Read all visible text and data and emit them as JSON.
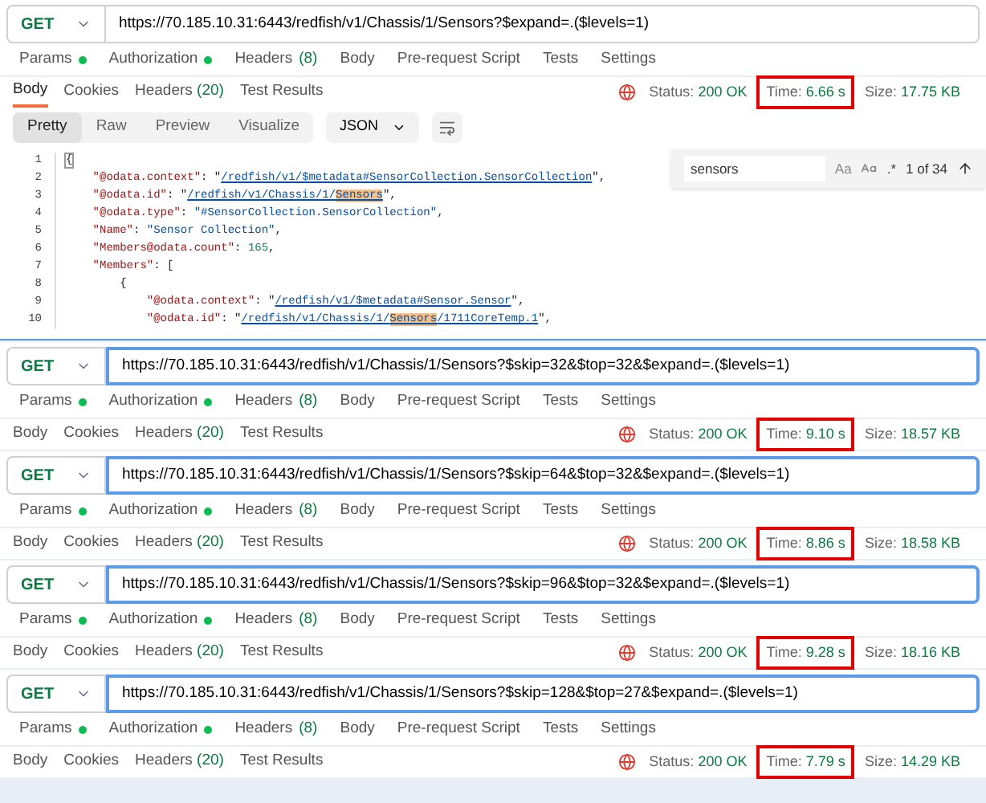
{
  "panels": [
    {
      "method": "GET",
      "url": "https://70.185.10.31:6443/redfish/v1/Chassis/1/Sensors?$expand=.($levels=1)",
      "focused": false,
      "request_tabs": [
        {
          "label": "Params",
          "dot": true
        },
        {
          "label": "Authorization",
          "dot": true
        },
        {
          "label": "Headers",
          "count": "(8)",
          "dot": false
        },
        {
          "label": "Body",
          "dot": false
        },
        {
          "label": "Pre-request Script",
          "dot": false
        },
        {
          "label": "Tests",
          "dot": false
        },
        {
          "label": "Settings",
          "dot": false
        }
      ],
      "response_tabs": [
        {
          "label": "Body",
          "selected": true
        },
        {
          "label": "Cookies",
          "selected": false
        },
        {
          "label": "Headers",
          "count": "(20)",
          "selected": false
        },
        {
          "label": "Test Results",
          "selected": false
        }
      ],
      "status_label": "Status:",
      "status": "200 OK",
      "time_label": "Time:",
      "time": "6.66 s",
      "time_highlighted": true,
      "size_label": "Size:",
      "size": "17.75 KB"
    },
    {
      "method": "GET",
      "url": "https://70.185.10.31:6443/redfish/v1/Chassis/1/Sensors?$skip=32&$top=32&$expand=.($levels=1)",
      "focused": true,
      "request_tabs": [
        {
          "label": "Params",
          "dot": true
        },
        {
          "label": "Authorization",
          "dot": true
        },
        {
          "label": "Headers",
          "count": "(8)",
          "dot": false
        },
        {
          "label": "Body",
          "dot": false
        },
        {
          "label": "Pre-request Script",
          "dot": false
        },
        {
          "label": "Tests",
          "dot": false
        },
        {
          "label": "Settings",
          "dot": false
        }
      ],
      "response_tabs": [
        {
          "label": "Body",
          "selected": false
        },
        {
          "label": "Cookies",
          "selected": false
        },
        {
          "label": "Headers",
          "count": "(20)",
          "selected": false
        },
        {
          "label": "Test Results",
          "selected": false
        }
      ],
      "status_label": "Status:",
      "status": "200 OK",
      "time_label": "Time:",
      "time": "9.10 s",
      "time_highlighted": true,
      "size_label": "Size:",
      "size": "18.57 KB"
    },
    {
      "method": "GET",
      "url": "https://70.185.10.31:6443/redfish/v1/Chassis/1/Sensors?$skip=64&$top=32&$expand=.($levels=1)",
      "focused": true,
      "request_tabs": [
        {
          "label": "Params",
          "dot": true
        },
        {
          "label": "Authorization",
          "dot": true
        },
        {
          "label": "Headers",
          "count": "(8)",
          "dot": false
        },
        {
          "label": "Body",
          "dot": false
        },
        {
          "label": "Pre-request Script",
          "dot": false
        },
        {
          "label": "Tests",
          "dot": false
        },
        {
          "label": "Settings",
          "dot": false
        }
      ],
      "response_tabs": [
        {
          "label": "Body",
          "selected": false
        },
        {
          "label": "Cookies",
          "selected": false
        },
        {
          "label": "Headers",
          "count": "(20)",
          "selected": false
        },
        {
          "label": "Test Results",
          "selected": false
        }
      ],
      "status_label": "Status:",
      "status": "200 OK",
      "time_label": "Time:",
      "time": "8.86 s",
      "time_highlighted": true,
      "size_label": "Size:",
      "size": "18.58 KB"
    },
    {
      "method": "GET",
      "url": "https://70.185.10.31:6443/redfish/v1/Chassis/1/Sensors?$skip=96&$top=32&$expand=.($levels=1)",
      "focused": true,
      "request_tabs": [
        {
          "label": "Params",
          "dot": true
        },
        {
          "label": "Authorization",
          "dot": true
        },
        {
          "label": "Headers",
          "count": "(8)",
          "dot": false
        },
        {
          "label": "Body",
          "dot": false
        },
        {
          "label": "Pre-request Script",
          "dot": false
        },
        {
          "label": "Tests",
          "dot": false
        },
        {
          "label": "Settings",
          "dot": false
        }
      ],
      "response_tabs": [
        {
          "label": "Body",
          "selected": false
        },
        {
          "label": "Cookies",
          "selected": false
        },
        {
          "label": "Headers",
          "count": "(20)",
          "selected": false
        },
        {
          "label": "Test Results",
          "selected": false
        }
      ],
      "status_label": "Status:",
      "status": "200 OK",
      "time_label": "Time:",
      "time": "9.28 s",
      "time_highlighted": true,
      "size_label": "Size:",
      "size": "18.16 KB"
    },
    {
      "method": "GET",
      "url": "https://70.185.10.31:6443/redfish/v1/Chassis/1/Sensors?$skip=128&$top=27&$expand=.($levels=1)",
      "focused": true,
      "request_tabs": [
        {
          "label": "Params",
          "dot": true
        },
        {
          "label": "Authorization",
          "dot": true
        },
        {
          "label": "Headers",
          "count": "(8)",
          "dot": false
        },
        {
          "label": "Body",
          "dot": false
        },
        {
          "label": "Pre-request Script",
          "dot": false
        },
        {
          "label": "Tests",
          "dot": false
        },
        {
          "label": "Settings",
          "dot": false
        }
      ],
      "response_tabs": [
        {
          "label": "Body",
          "selected": false
        },
        {
          "label": "Cookies",
          "selected": false
        },
        {
          "label": "Headers",
          "count": "(20)",
          "selected": false
        },
        {
          "label": "Test Results",
          "selected": false
        }
      ],
      "status_label": "Status:",
      "status": "200 OK",
      "time_label": "Time:",
      "time": "7.79 s",
      "time_highlighted": true,
      "size_label": "Size:",
      "size": "14.29 KB"
    }
  ],
  "view_modes": [
    {
      "label": "Pretty",
      "selected": true
    },
    {
      "label": "Raw",
      "selected": false
    },
    {
      "label": "Preview",
      "selected": false
    },
    {
      "label": "Visualize",
      "selected": false
    }
  ],
  "format": "JSON",
  "search": {
    "value": "sensors",
    "case_toggle": "Aa",
    "regex_toggle": ".*",
    "count": "1 of 34"
  },
  "code_lines": [
    {
      "number": "1",
      "tokens": [
        {
          "kind": "bracket",
          "text": "{"
        }
      ]
    },
    {
      "number": "2",
      "tokens": [
        {
          "kind": "key",
          "text": "    \"@odata.context\""
        },
        {
          "kind": "punct",
          "text": ": \""
        },
        {
          "kind": "link",
          "parts": [
            {
              "text": "/redfish/v1/$metadata#SensorCollection.SensorCollection",
              "match": false
            }
          ]
        },
        {
          "kind": "punct",
          "text": "\","
        }
      ]
    },
    {
      "number": "3",
      "tokens": [
        {
          "kind": "key",
          "text": "    \"@odata.id\""
        },
        {
          "kind": "punct",
          "text": ": \""
        },
        {
          "kind": "link",
          "parts": [
            {
              "text": "/redfish/v1/Chassis/1/",
              "match": false
            },
            {
              "text": "Sensors",
              "match": true
            }
          ]
        },
        {
          "kind": "punct",
          "text": "\","
        }
      ]
    },
    {
      "number": "4",
      "tokens": [
        {
          "kind": "key",
          "text": "    \"@odata.type\""
        },
        {
          "kind": "punct",
          "text": ": "
        },
        {
          "kind": "string",
          "text": "\"#SensorCollection.SensorCollection\""
        },
        {
          "kind": "punct",
          "text": ","
        }
      ]
    },
    {
      "number": "5",
      "tokens": [
        {
          "kind": "key",
          "text": "    \"Name\""
        },
        {
          "kind": "punct",
          "text": ": "
        },
        {
          "kind": "string",
          "text": "\"Sensor Collection\""
        },
        {
          "kind": "punct",
          "text": ","
        }
      ]
    },
    {
      "number": "6",
      "tokens": [
        {
          "kind": "key",
          "text": "    \"Members@odata.count\""
        },
        {
          "kind": "punct",
          "text": ": "
        },
        {
          "kind": "number",
          "text": "165"
        },
        {
          "kind": "punct",
          "text": ","
        }
      ]
    },
    {
      "number": "7",
      "tokens": [
        {
          "kind": "key",
          "text": "    \"Members\""
        },
        {
          "kind": "punct",
          "text": ": ["
        }
      ]
    },
    {
      "number": "8",
      "tokens": [
        {
          "kind": "punct",
          "text": "        {"
        }
      ]
    },
    {
      "number": "9",
      "tokens": [
        {
          "kind": "key",
          "text": "            \"@odata.context\""
        },
        {
          "kind": "punct",
          "text": ": \""
        },
        {
          "kind": "link",
          "parts": [
            {
              "text": "/redfish/v1/$metadata#Sensor.Sensor",
              "match": false
            }
          ]
        },
        {
          "kind": "punct",
          "text": "\","
        }
      ]
    },
    {
      "number": "10",
      "tokens": [
        {
          "kind": "key",
          "text": "            \"@odata.id\""
        },
        {
          "kind": "punct",
          "text": ": \""
        },
        {
          "kind": "link",
          "parts": [
            {
              "text": "/redfish/v1/Chassis/1/",
              "match": false
            },
            {
              "text": "Sensors",
              "match": true
            },
            {
              "text": "/1711CoreTemp.1",
              "match": false
            }
          ]
        },
        {
          "kind": "punct",
          "text": "\","
        }
      ]
    }
  ]
}
